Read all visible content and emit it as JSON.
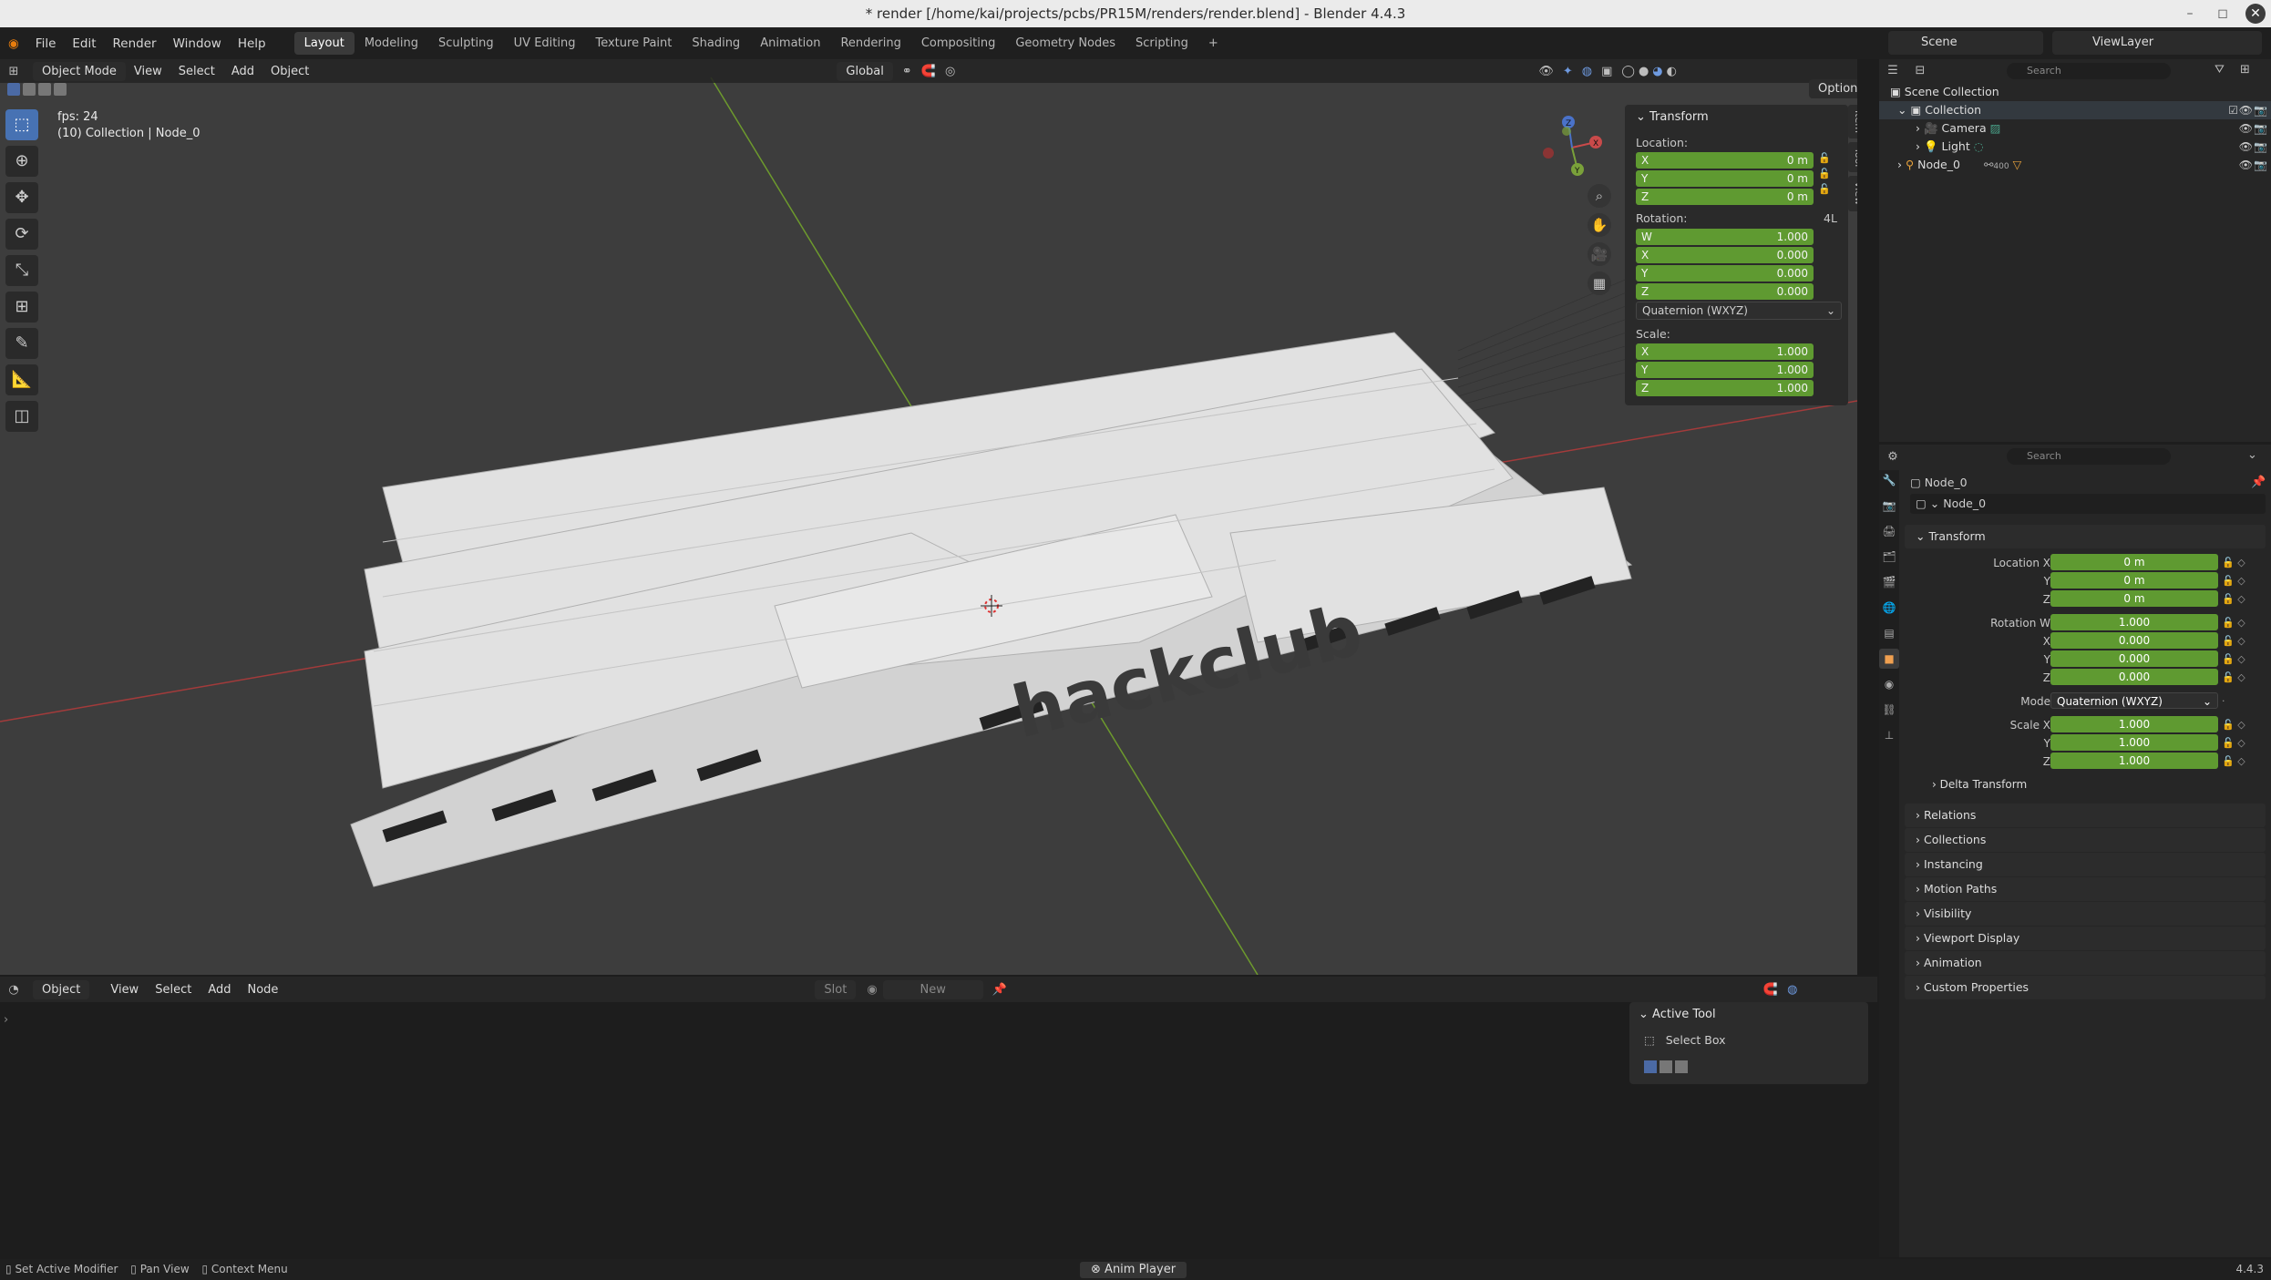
{
  "window": {
    "title": "* render [/home/kai/projects/pcbs/PR15M/renders/render.blend] - Blender 4.4.3"
  },
  "menu": [
    "File",
    "Edit",
    "Render",
    "Window",
    "Help"
  ],
  "workspaces": [
    "Layout",
    "Modeling",
    "Sculpting",
    "UV Editing",
    "Texture Paint",
    "Shading",
    "Animation",
    "Rendering",
    "Compositing",
    "Geometry Nodes",
    "Scripting"
  ],
  "active_workspace": "Layout",
  "scene": "Scene",
  "view_layer": "ViewLayer",
  "viewport": {
    "mode": "Object Mode",
    "menus": [
      "View",
      "Select",
      "Add",
      "Object"
    ],
    "orientation": "Global",
    "fps": "fps: 24",
    "collection_info": "(10) Collection | Node_0",
    "options": "Options",
    "overlay_text": "hackclub"
  },
  "npanel": {
    "title": "Transform",
    "location_label": "Location:",
    "location": [
      {
        "axis": "X",
        "value": "0 m"
      },
      {
        "axis": "Y",
        "value": "0 m"
      },
      {
        "axis": "Z",
        "value": "0 m"
      }
    ],
    "rotation_label": "Rotation:",
    "rotation_lock": "4L",
    "rotation": [
      {
        "axis": "W",
        "value": "1.000"
      },
      {
        "axis": "X",
        "value": "0.000"
      },
      {
        "axis": "Y",
        "value": "0.000"
      },
      {
        "axis": "Z",
        "value": "0.000"
      }
    ],
    "rotation_mode": "Quaternion (WXYZ)",
    "scale_label": "Scale:",
    "scale": [
      {
        "axis": "X",
        "value": "1.000"
      },
      {
        "axis": "Y",
        "value": "1.000"
      },
      {
        "axis": "Z",
        "value": "1.000"
      }
    ],
    "tabs": [
      "Item",
      "Tool",
      "View"
    ]
  },
  "node_editor": {
    "type": "Object",
    "menus": [
      "View",
      "Select",
      "Add",
      "Node"
    ],
    "slot": "Slot",
    "new": "New",
    "active_tool_title": "Active Tool",
    "active_tool": "Select Box"
  },
  "outliner": {
    "search": "Search",
    "rows": [
      {
        "label": "Scene Collection",
        "indent": 0
      },
      {
        "label": "Collection",
        "indent": 1
      },
      {
        "label": "Camera",
        "indent": 2
      },
      {
        "label": "Light",
        "indent": 2
      },
      {
        "label": "Node_0",
        "indent": 1
      }
    ],
    "node_badge": "400"
  },
  "properties": {
    "search": "Search",
    "object": "Node_0",
    "datablock": "Node_0",
    "transform_title": "Transform",
    "rows": [
      {
        "label": "Location X",
        "value": "0 m"
      },
      {
        "label": "Y",
        "value": "0 m"
      },
      {
        "label": "Z",
        "value": "0 m"
      },
      {
        "label": "Rotation W",
        "value": "1.000"
      },
      {
        "label": "X",
        "value": "0.000"
      },
      {
        "label": "Y",
        "value": "0.000"
      },
      {
        "label": "Z",
        "value": "0.000"
      }
    ],
    "mode_label": "Mode",
    "mode_value": "Quaternion (WXYZ)",
    "scale_rows": [
      {
        "label": "Scale X",
        "value": "1.000"
      },
      {
        "label": "Y",
        "value": "1.000"
      },
      {
        "label": "Z",
        "value": "1.000"
      }
    ],
    "delta": "Delta Transform",
    "sections": [
      "Relations",
      "Collections",
      "Instancing",
      "Motion Paths",
      "Visibility",
      "Viewport Display",
      "Animation",
      "Custom Properties"
    ]
  },
  "status": {
    "left": [
      "Set Active Modifier",
      "Pan View",
      "Context Menu"
    ],
    "center": "Anim Player",
    "version": "4.4.3"
  }
}
